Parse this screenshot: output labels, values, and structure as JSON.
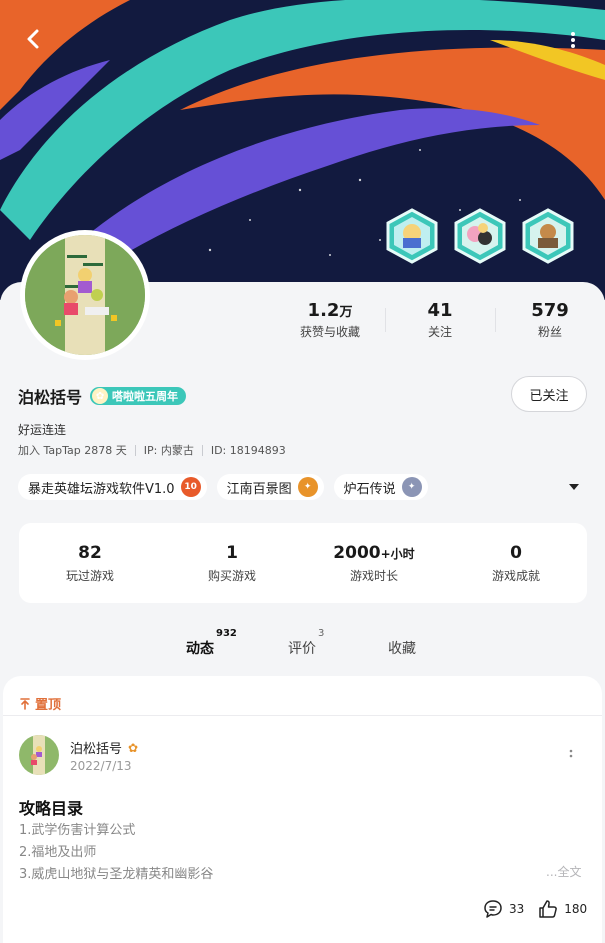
{
  "header": {
    "back_icon": "chevron-left-icon",
    "more_icon": "vertical-dots-icon"
  },
  "badges": [
    "badge-hex-1",
    "badge-hex-2",
    "badge-hex-3"
  ],
  "profile": {
    "name": "泊松括号",
    "anniversary_label": "嗒啦啦五周年",
    "follow_label": "已关注",
    "bio": "好运连连",
    "joined": "加入 TapTap 2878 天",
    "ip": "IP: 内蒙古",
    "id": "ID: 18194893"
  },
  "stats": {
    "likes_num": "1.2",
    "likes_unit": "万",
    "likes_label": "获赞与收藏",
    "following_num": "41",
    "following_label": "关注",
    "fans_num": "579",
    "fans_label": "粉丝"
  },
  "tags": [
    {
      "label": "暴走英雄坛游戏软件V1.0",
      "level": "10",
      "color": "#e85a2a"
    },
    {
      "label": "江南百景图",
      "level": "",
      "color": "#e8932a"
    },
    {
      "label": "炉石传说",
      "level": "",
      "color": "#8b95b5"
    }
  ],
  "game_stats": {
    "played_num": "82",
    "played_label": "玩过游戏",
    "bought_num": "1",
    "bought_label": "购买游戏",
    "hours_num": "2000",
    "hours_suffix": "+小时",
    "hours_label": "游戏时长",
    "achievements_num": "0",
    "achievements_label": "游戏成就"
  },
  "tabs": {
    "feed_label": "动态",
    "feed_count": "932",
    "reviews_label": "评价",
    "reviews_count": "3",
    "favorites_label": "收藏"
  },
  "post": {
    "pinned_label": "置顶",
    "author": "泊松括号",
    "date": "2022/7/13",
    "title": "攻略目录",
    "lines": [
      "1.武学伤害计算公式",
      "2.福地及出师",
      "3.威虎山地狱与圣龙精英和幽影谷"
    ],
    "full_text_label": "...全文",
    "comments": "33",
    "likes": "180"
  },
  "colors": {
    "accent": "#3cc7b9",
    "pinned": "#e0703a",
    "banner_bg": "#121a3f"
  }
}
